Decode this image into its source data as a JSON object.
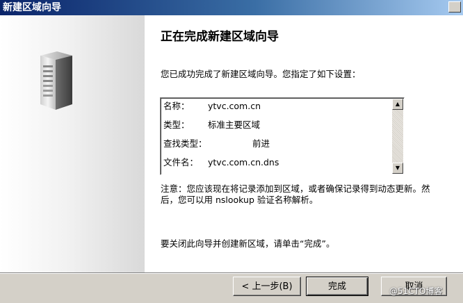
{
  "window": {
    "title": "新建区域向导"
  },
  "main": {
    "heading": "正在完成新建区域向导",
    "intro": "您已成功完成了新建区域向导。您指定了如下设置：",
    "settings": [
      {
        "label": "名称：",
        "value": "ytvc.com.cn"
      },
      {
        "label": "类型：",
        "value": "标准主要区域"
      },
      {
        "label": "查找类型：",
        "value": "前进"
      },
      {
        "label": "文件名：",
        "value": "ytvc.com.cn.dns"
      }
    ],
    "note": "注意：您应该现在将记录添加到区域，或者确保记录得到动态更新。然后，您可以用 nslookup 验证名称解析。",
    "closing": "要关闭此向导并创建新区域，请单击“完成”。"
  },
  "buttons": {
    "back": "< 上一步(B)",
    "finish": "完成",
    "cancel": "取消"
  },
  "watermark": "@51CTO博客",
  "icons": {
    "server": "server-icon",
    "scroll_up": "scroll-up-icon",
    "scroll_down": "scroll-down-icon"
  }
}
